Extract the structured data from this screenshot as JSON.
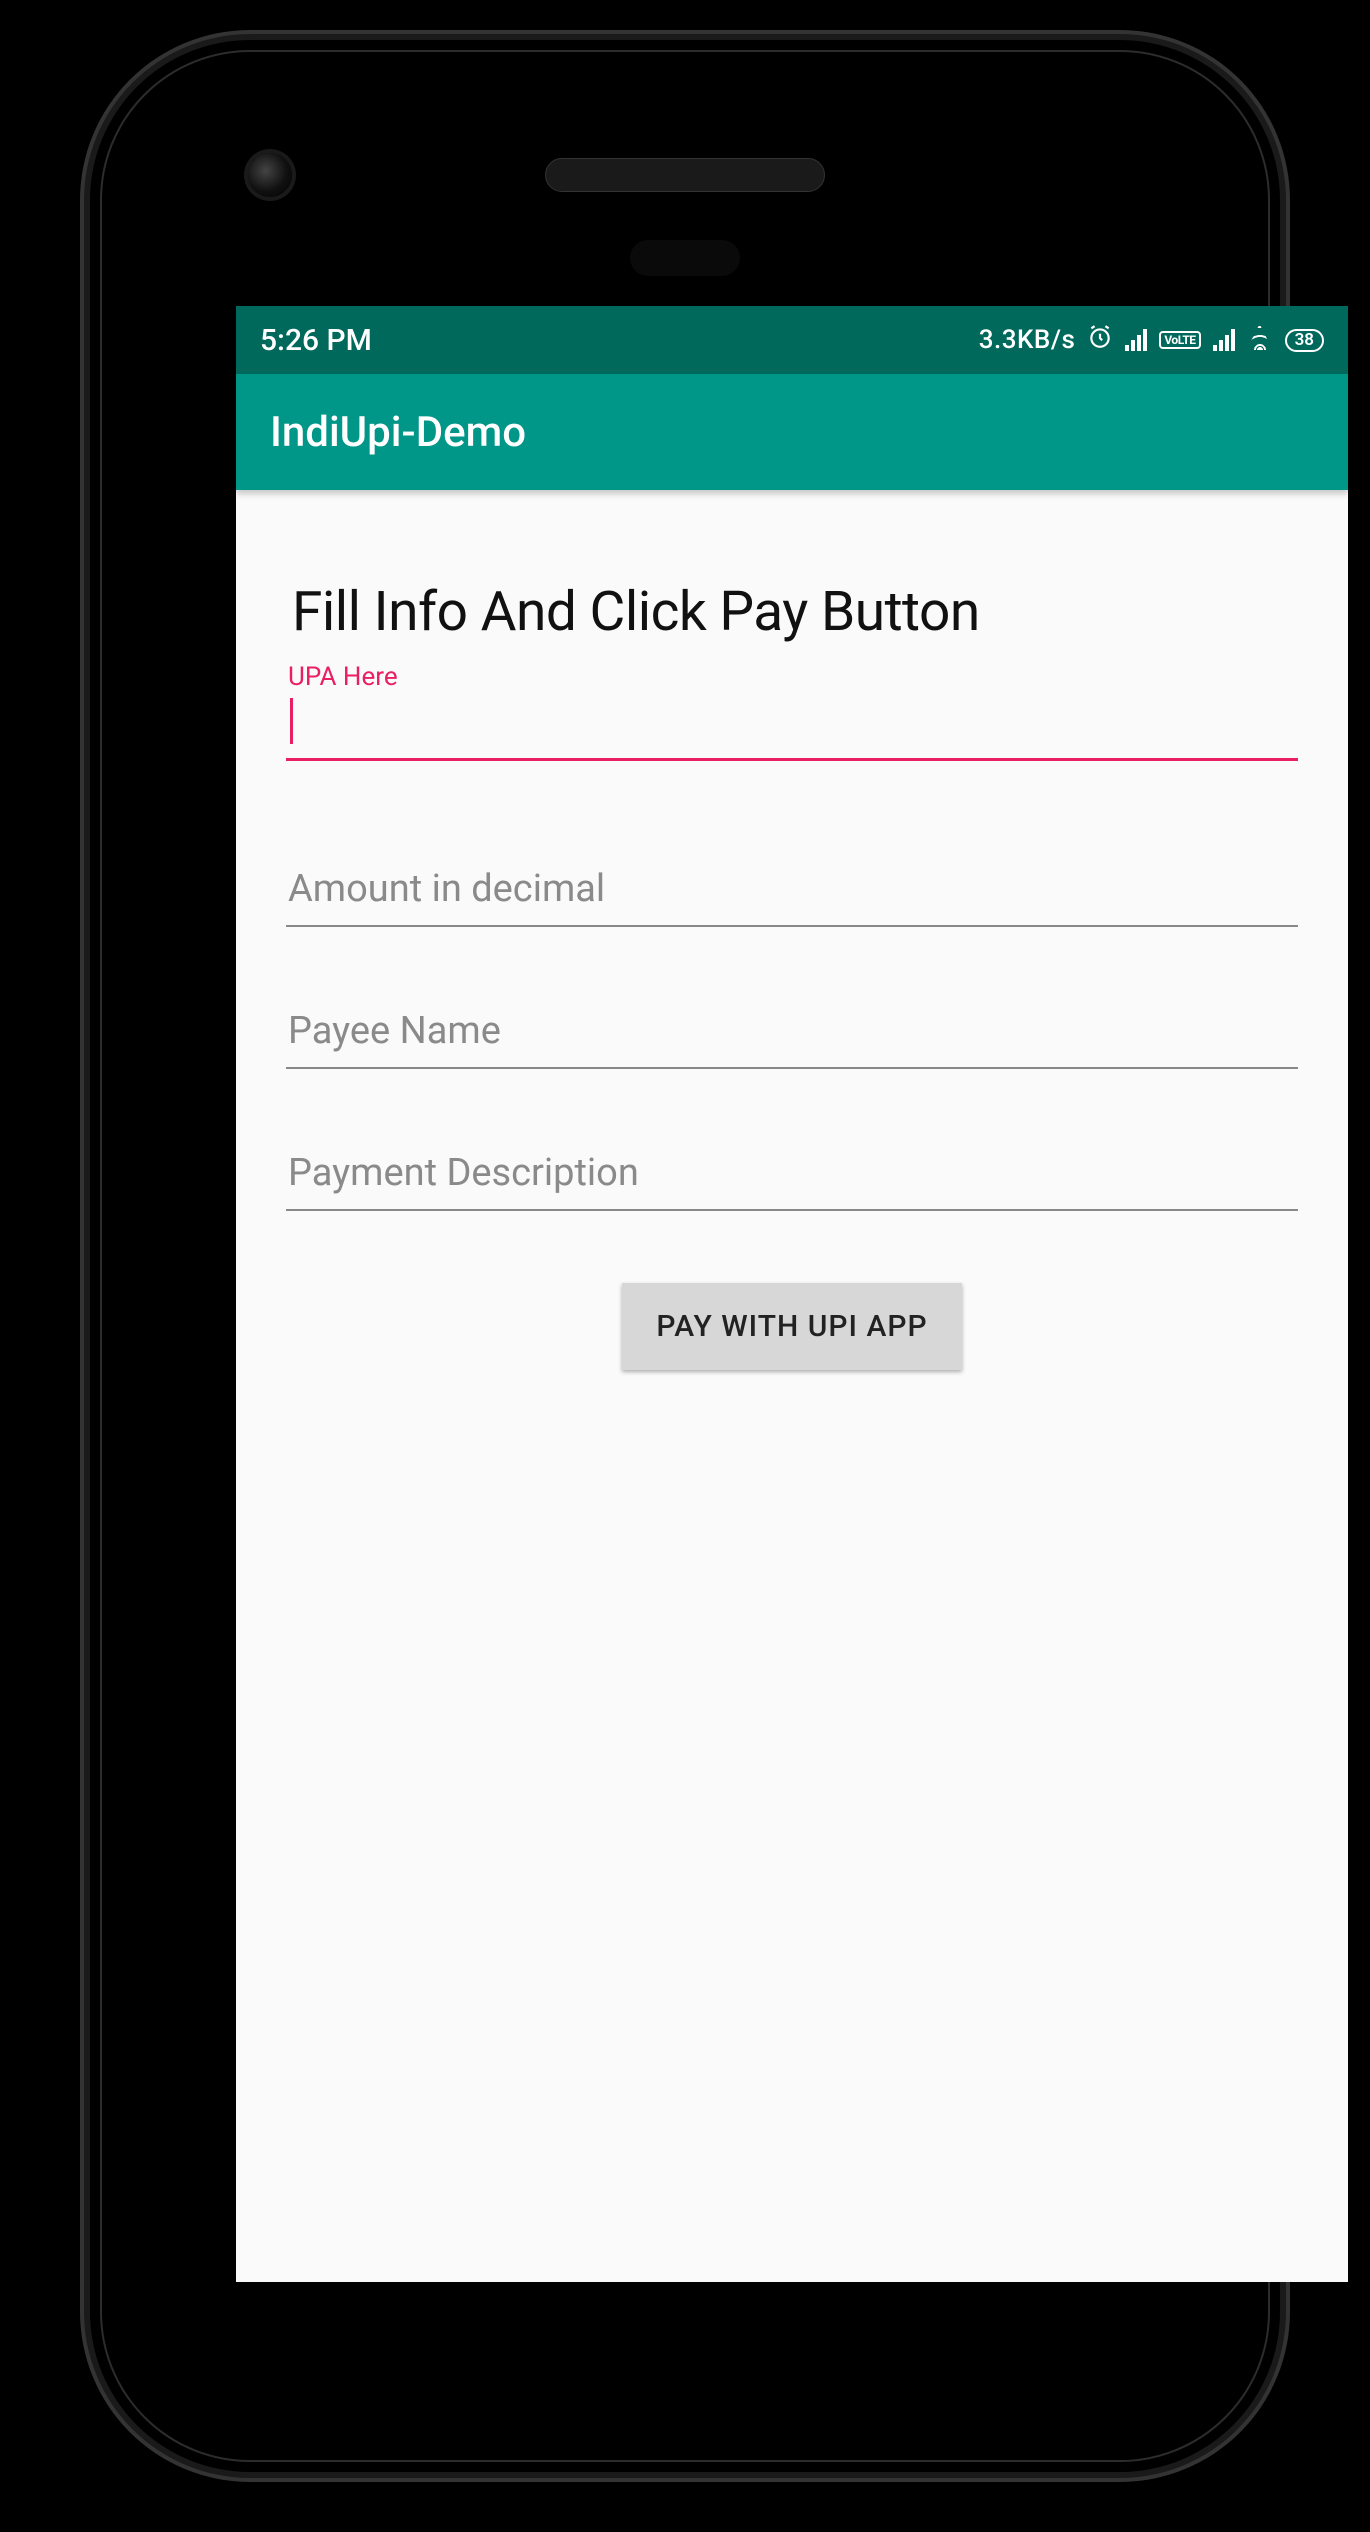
{
  "status": {
    "time": "5:26 PM",
    "net_speed": "3.3KB/s",
    "battery_pct": "38",
    "volte_label": "VoLTE"
  },
  "appbar": {
    "title": "IndiUpi-Demo"
  },
  "page": {
    "heading": "Fill Info And Click Pay Button"
  },
  "form": {
    "upa": {
      "label": "UPA Here",
      "value": ""
    },
    "amount": {
      "placeholder": "Amount in decimal",
      "value": ""
    },
    "payee": {
      "placeholder": "Payee Name",
      "value": ""
    },
    "desc": {
      "placeholder": "Payment Description",
      "value": ""
    },
    "pay_button_label": "PAY WITH UPI APP"
  }
}
